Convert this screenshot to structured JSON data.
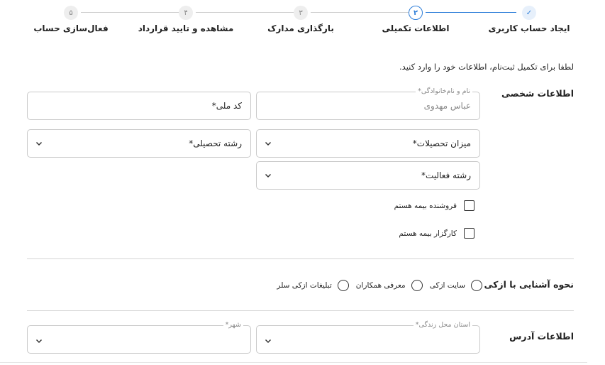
{
  "stepper": {
    "steps": [
      {
        "number": "✓",
        "label": "ایجاد حساب کاربری",
        "state": "done"
      },
      {
        "number": "۲",
        "label": "اطلاعات تکمیلی",
        "state": "active"
      },
      {
        "number": "۳",
        "label": "بارگذاری مدارک",
        "state": "pending"
      },
      {
        "number": "۴",
        "label": "مشاهده و تایید قرارداد",
        "state": "pending"
      },
      {
        "number": "۵",
        "label": "فعال‌سازی حساب",
        "state": "pending"
      }
    ]
  },
  "intro": "لطفا برای تکمیل ثبت‌نام، اطلاعات خود را وارد کنید.",
  "personal": {
    "title": "اطلاعات شخصی",
    "name_label": "نام و نام‌خانوادگی*",
    "name_value": "عباس مهدوی",
    "national_code": "کد ملی*",
    "education_level": "میزان تحصیلات*",
    "field_of_study": "رشته تحصیلی*",
    "activity_field": "رشته فعالیت*",
    "checkbox_seller": "فروشنده بیمه هستم",
    "checkbox_broker": "کارگزار بیمه هستم"
  },
  "acquaintance": {
    "title": "نحوه آشنایی با ازکی",
    "options": [
      "سایت ازکی",
      "معرفی همکاران",
      "تبلیغات ازکی سلر"
    ]
  },
  "address": {
    "title": "اطلاعات آدرس",
    "province_label": "استان محل زندگی*",
    "city_label": "شهر*"
  }
}
